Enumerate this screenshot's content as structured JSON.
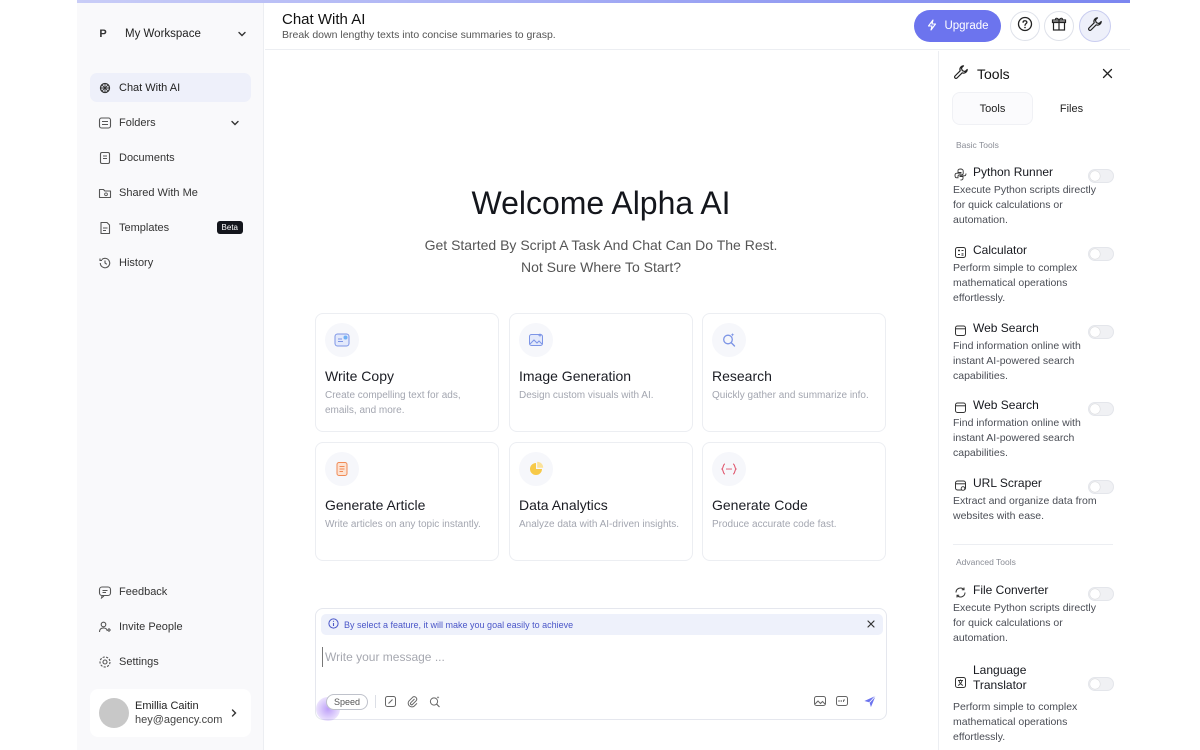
{
  "workspace": {
    "badge": "P",
    "name": "My Workspace"
  },
  "sidebar": {
    "items": [
      {
        "label": "Chat With AI",
        "icon": "openai-icon",
        "active": true
      },
      {
        "label": "Folders",
        "icon": "folder-icon"
      },
      {
        "label": "Documents",
        "icon": "document-icon"
      },
      {
        "label": "Shared With Me",
        "icon": "shared-folder-icon"
      },
      {
        "label": "Templates",
        "icon": "template-icon",
        "badge": "Beta"
      },
      {
        "label": "History",
        "icon": "history-icon"
      }
    ],
    "bottom": [
      {
        "label": "Feedback",
        "icon": "feedback-icon"
      },
      {
        "label": "Invite People",
        "icon": "invite-icon"
      },
      {
        "label": "Settings",
        "icon": "settings-icon"
      }
    ],
    "user": {
      "name": "Emillia Caitin",
      "email": "hey@agency.com"
    }
  },
  "header": {
    "title": "Chat With AI",
    "subtitle": "Break down lengthy texts into concise summaries to grasp.",
    "upgrade_label": "Upgrade"
  },
  "main": {
    "welcome": "Welcome Alpha AI",
    "sub_line1": "Get Started By Script A Task And Chat Can Do The Rest.",
    "sub_line2": "Not Sure Where To Start?",
    "cards": [
      {
        "title": "Write Copy",
        "desc": "Create compelling text for ads, emails, and more.",
        "icon": "write-copy-icon"
      },
      {
        "title": "Image Generation",
        "desc": "Design custom visuals with AI.",
        "icon": "image-generation-icon"
      },
      {
        "title": "Research",
        "desc": "Quickly gather and summarize info.",
        "icon": "research-icon"
      },
      {
        "title": "Generate Article",
        "desc": "Write articles on any topic instantly.",
        "icon": "article-icon"
      },
      {
        "title": "Data Analytics",
        "desc": "Analyze data with AI-driven insights.",
        "icon": "pie-chart-icon"
      },
      {
        "title": "Generate Code",
        "desc": "Produce accurate code fast.",
        "icon": "code-icon"
      }
    ]
  },
  "composer": {
    "hint": "By select a feature, it will make you goal easily to achieve",
    "placeholder": "Write your message ...",
    "speed_label": "Speed"
  },
  "tools_panel": {
    "title": "Tools",
    "tabs": [
      "Tools",
      "Files"
    ],
    "active_tab": "Tools",
    "basic_label": "Basic Tools",
    "advanced_label": "Advanced Tools",
    "basic": [
      {
        "name": "Python Runner",
        "desc": "Execute Python scripts directly for quick calculations or automation.",
        "icon": "python-icon",
        "enabled": false
      },
      {
        "name": "Calculator",
        "desc": "Perform simple to complex mathematical operations effortlessly.",
        "icon": "calculator-icon",
        "enabled": false
      },
      {
        "name": "Web Search",
        "desc": "Find information online with instant AI-powered search capabilities.",
        "icon": "browser-icon",
        "enabled": false
      },
      {
        "name": "Web Search",
        "desc": "Find information online with instant AI-powered search capabilities.",
        "icon": "browser-icon",
        "enabled": false
      },
      {
        "name": "URL Scraper",
        "desc": "Extract and organize data from websites with ease.",
        "icon": "scraper-icon",
        "enabled": false
      }
    ],
    "advanced": [
      {
        "name": "File Converter",
        "desc": "Execute Python scripts directly for quick calculations or automation.",
        "icon": "convert-icon",
        "enabled": false
      },
      {
        "name": "Language Translator",
        "desc": "Perform simple to complex mathematical operations effortlessly.",
        "icon": "translate-icon",
        "enabled": false
      }
    ]
  },
  "colors": {
    "accent": "#6c74ee",
    "hint_bg": "#eef1fb",
    "hint_text": "#4a56c8"
  }
}
